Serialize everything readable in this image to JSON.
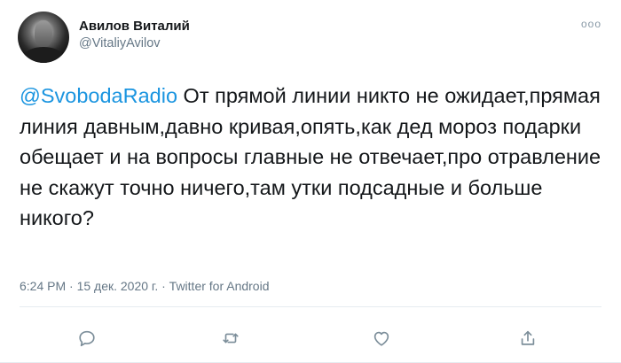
{
  "tweet": {
    "author_name": "Авилов Виталий",
    "author_handle": "@VitaliyAvilov",
    "more_label": "ooo",
    "mention": "@SvobodaRadio",
    "text": " От прямой линии никто не ожидает,прямая линия давным,давно кривая,опять,как дед мороз подарки обещает и на вопросы главные не отвечает,про  отравление не скажут точно ничего,там утки подсадные и больше никого?",
    "meta": "6:24 PM · 15 дек. 2020 г. · Twitter for Android"
  },
  "icons": {
    "reply": "reply-icon",
    "retweet": "retweet-icon",
    "like": "like-icon",
    "share": "share-icon"
  },
  "colors": {
    "mention": "#1b95e0",
    "secondary_text": "#657786",
    "icon": "#7b8d99"
  }
}
